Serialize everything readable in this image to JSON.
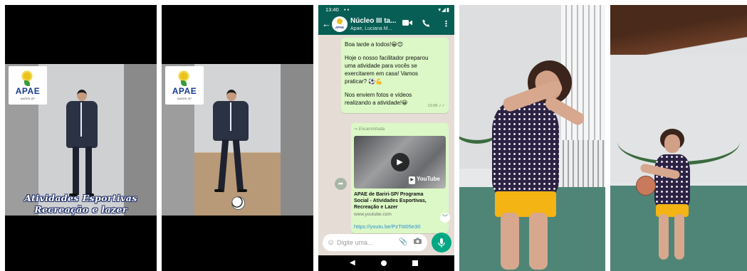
{
  "panel1": {
    "logo": {
      "brand": "APAE",
      "sub": "BARIRI-SP"
    },
    "caption_line1": "Atividades Esportivas",
    "caption_line2": "Recreação e lazer"
  },
  "panel2": {
    "logo": {
      "brand": "APAE",
      "sub": "BARIRI-SP"
    }
  },
  "whatsapp": {
    "status_time": "13:40",
    "group_name": "Núcleo III ta...",
    "group_members": "Apae, Luciana M...",
    "avatar_text": "APAE",
    "message": {
      "line1": "Boa tarde a todos!😀😊",
      "line2": "Hoje o nosso facilitador preparou",
      "line3": "uma atividade para vocês se",
      "line4": "exercitarem em casa! Vamos",
      "line5": "praticar? ⚽💪",
      "line6": "Nos enviem fotos e vídeos",
      "line7": "realizando a atividade!😀",
      "time": "13:08 ✓✓"
    },
    "forwarded": {
      "label": "↪ Encaminhada",
      "yt_label": "YouTube",
      "title_line1": "APAE de Bariri-SP/ Programa",
      "title_line2": "Social - Atividades Esportivas,",
      "title_line3": "Recreação e Lazer",
      "domain": "www.youtube.com",
      "url": "https://youtu.be/PzTtit05e30"
    },
    "input_placeholder": "Digite uma..."
  },
  "colors": {
    "whatsapp_green": "#075e54",
    "bubble": "#dcf8c6",
    "chat_bg": "#e5ddd5",
    "mic": "#00a884",
    "apae_blue": "#173a8c"
  },
  "icons": {
    "back": "arrow-left-icon",
    "video_call": "video-camera-icon",
    "call": "phone-icon",
    "menu": "more-vertical-icon",
    "play": "play-icon",
    "share": "share-icon",
    "emoji": "emoji-icon",
    "attach": "paperclip-icon",
    "camera": "camera-icon",
    "mic": "microphone-icon"
  }
}
